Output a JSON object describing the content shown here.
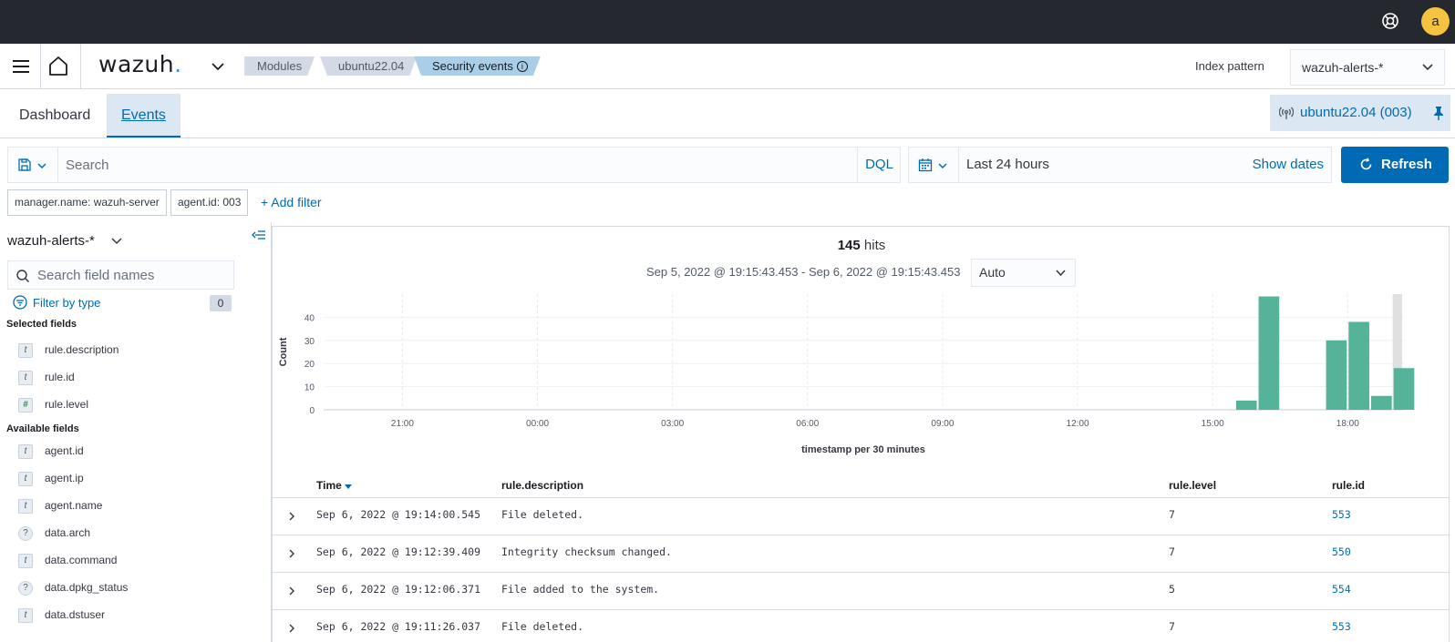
{
  "topbar": {
    "help_icon": "help-lifebuoy-icon",
    "avatar_initial": "a"
  },
  "header": {
    "app_name": "wazuh",
    "app_dot": ".",
    "breadcrumbs": [
      {
        "label": "Modules",
        "info": ""
      },
      {
        "label": "ubuntu22.04",
        "info": ""
      },
      {
        "label": "Security events",
        "info": "i"
      }
    ],
    "index_pattern_label": "Index pattern",
    "index_pattern_value": "wazuh-alerts-*"
  },
  "tabs": [
    {
      "label": "Dashboard",
      "active": false
    },
    {
      "label": "Events",
      "active": true
    }
  ],
  "agent_pill": {
    "label": "ubuntu22.04 (003)"
  },
  "search": {
    "placeholder": "Search",
    "language": "DQL",
    "time_range": "Last 24 hours",
    "show_dates": "Show dates",
    "refresh": "Refresh"
  },
  "filters": {
    "pills": [
      "manager.name: wazuh-server",
      "agent.id: 003"
    ],
    "add_filter": "+ Add filter"
  },
  "sidebar": {
    "index_pattern": "wazuh-alerts-*",
    "search_placeholder": "Search field names",
    "filter_by_type": "Filter by type",
    "filter_count": "0",
    "selected_title": "Selected fields",
    "selected_fields": [
      {
        "type": "t",
        "name": "rule.description"
      },
      {
        "type": "t",
        "name": "rule.id"
      },
      {
        "type": "#",
        "name": "rule.level"
      }
    ],
    "available_title": "Available fields",
    "available_fields": [
      {
        "type": "t",
        "name": "agent.id"
      },
      {
        "type": "t",
        "name": "agent.ip"
      },
      {
        "type": "t",
        "name": "agent.name"
      },
      {
        "type": "?",
        "name": "data.arch"
      },
      {
        "type": "t",
        "name": "data.command"
      },
      {
        "type": "?",
        "name": "data.dpkg_status"
      },
      {
        "type": "t",
        "name": "data.dstuser"
      }
    ]
  },
  "histogram": {
    "hits_count": "145",
    "hits_label": "hits",
    "range_text": "Sep 5, 2022 @ 19:15:43.453 - Sep 6, 2022 @ 19:15:43.453",
    "interval": "Auto"
  },
  "chart_data": {
    "type": "bar",
    "xlabel": "timestamp per 30 minutes",
    "ylabel": "Count",
    "ylim": [
      0,
      50
    ],
    "yticks": [
      0,
      10,
      20,
      30,
      40
    ],
    "xticks": [
      "21:00",
      "00:00",
      "03:00",
      "06:00",
      "09:00",
      "12:00",
      "15:00",
      "18:00"
    ],
    "x_start": "19:15 Sep 5",
    "bar_color": "#54b399",
    "partial_bucket_color": "#e0e0e0",
    "bars": [
      {
        "time": "15:30",
        "value": 4
      },
      {
        "time": "16:00",
        "value": 49
      },
      {
        "time": "17:30",
        "value": 30
      },
      {
        "time": "18:00",
        "value": 38
      },
      {
        "time": "18:30",
        "value": 6
      },
      {
        "time": "19:00",
        "value": 18
      }
    ],
    "grid": true
  },
  "table": {
    "columns": [
      "Time",
      "rule.description",
      "rule.level",
      "rule.id"
    ],
    "rows": [
      {
        "time": "Sep 6, 2022 @ 19:14:00.545",
        "description": "File deleted.",
        "level": "7",
        "id": "553"
      },
      {
        "time": "Sep 6, 2022 @ 19:12:39.409",
        "description": "Integrity checksum changed.",
        "level": "7",
        "id": "550"
      },
      {
        "time": "Sep 6, 2022 @ 19:12:06.371",
        "description": "File added to the system.",
        "level": "5",
        "id": "554"
      },
      {
        "time": "Sep 6, 2022 @ 19:11:26.037",
        "description": "File deleted.",
        "level": "7",
        "id": "553"
      }
    ]
  }
}
